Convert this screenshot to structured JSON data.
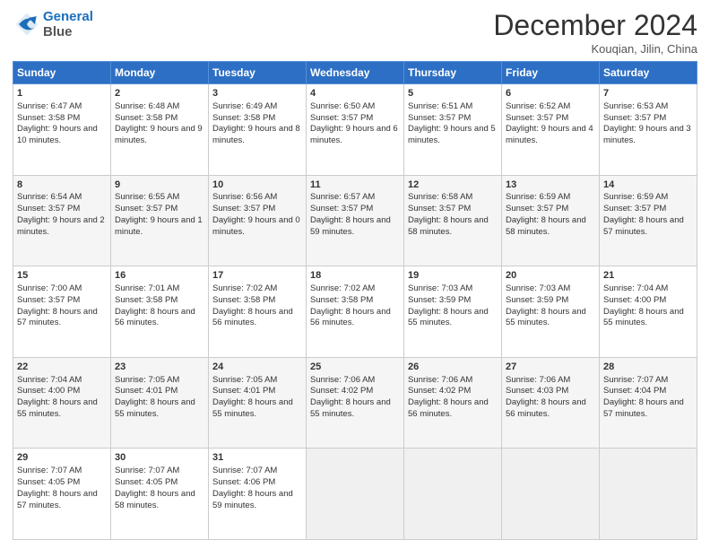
{
  "header": {
    "logo_line1": "General",
    "logo_line2": "Blue",
    "month": "December 2024",
    "location": "Kouqian, Jilin, China"
  },
  "weekdays": [
    "Sunday",
    "Monday",
    "Tuesday",
    "Wednesday",
    "Thursday",
    "Friday",
    "Saturday"
  ],
  "weeks": [
    [
      {
        "day": "1",
        "sunrise": "6:47 AM",
        "sunset": "3:58 PM",
        "daylight": "9 hours and 10 minutes."
      },
      {
        "day": "2",
        "sunrise": "6:48 AM",
        "sunset": "3:58 PM",
        "daylight": "9 hours and 9 minutes."
      },
      {
        "day": "3",
        "sunrise": "6:49 AM",
        "sunset": "3:58 PM",
        "daylight": "9 hours and 8 minutes."
      },
      {
        "day": "4",
        "sunrise": "6:50 AM",
        "sunset": "3:57 PM",
        "daylight": "9 hours and 6 minutes."
      },
      {
        "day": "5",
        "sunrise": "6:51 AM",
        "sunset": "3:57 PM",
        "daylight": "9 hours and 5 minutes."
      },
      {
        "day": "6",
        "sunrise": "6:52 AM",
        "sunset": "3:57 PM",
        "daylight": "9 hours and 4 minutes."
      },
      {
        "day": "7",
        "sunrise": "6:53 AM",
        "sunset": "3:57 PM",
        "daylight": "9 hours and 3 minutes."
      }
    ],
    [
      {
        "day": "8",
        "sunrise": "6:54 AM",
        "sunset": "3:57 PM",
        "daylight": "9 hours and 2 minutes."
      },
      {
        "day": "9",
        "sunrise": "6:55 AM",
        "sunset": "3:57 PM",
        "daylight": "9 hours and 1 minute."
      },
      {
        "day": "10",
        "sunrise": "6:56 AM",
        "sunset": "3:57 PM",
        "daylight": "9 hours and 0 minutes."
      },
      {
        "day": "11",
        "sunrise": "6:57 AM",
        "sunset": "3:57 PM",
        "daylight": "8 hours and 59 minutes."
      },
      {
        "day": "12",
        "sunrise": "6:58 AM",
        "sunset": "3:57 PM",
        "daylight": "8 hours and 58 minutes."
      },
      {
        "day": "13",
        "sunrise": "6:59 AM",
        "sunset": "3:57 PM",
        "daylight": "8 hours and 58 minutes."
      },
      {
        "day": "14",
        "sunrise": "6:59 AM",
        "sunset": "3:57 PM",
        "daylight": "8 hours and 57 minutes."
      }
    ],
    [
      {
        "day": "15",
        "sunrise": "7:00 AM",
        "sunset": "3:57 PM",
        "daylight": "8 hours and 57 minutes."
      },
      {
        "day": "16",
        "sunrise": "7:01 AM",
        "sunset": "3:58 PM",
        "daylight": "8 hours and 56 minutes."
      },
      {
        "day": "17",
        "sunrise": "7:02 AM",
        "sunset": "3:58 PM",
        "daylight": "8 hours and 56 minutes."
      },
      {
        "day": "18",
        "sunrise": "7:02 AM",
        "sunset": "3:58 PM",
        "daylight": "8 hours and 56 minutes."
      },
      {
        "day": "19",
        "sunrise": "7:03 AM",
        "sunset": "3:59 PM",
        "daylight": "8 hours and 55 minutes."
      },
      {
        "day": "20",
        "sunrise": "7:03 AM",
        "sunset": "3:59 PM",
        "daylight": "8 hours and 55 minutes."
      },
      {
        "day": "21",
        "sunrise": "7:04 AM",
        "sunset": "4:00 PM",
        "daylight": "8 hours and 55 minutes."
      }
    ],
    [
      {
        "day": "22",
        "sunrise": "7:04 AM",
        "sunset": "4:00 PM",
        "daylight": "8 hours and 55 minutes."
      },
      {
        "day": "23",
        "sunrise": "7:05 AM",
        "sunset": "4:01 PM",
        "daylight": "8 hours and 55 minutes."
      },
      {
        "day": "24",
        "sunrise": "7:05 AM",
        "sunset": "4:01 PM",
        "daylight": "8 hours and 55 minutes."
      },
      {
        "day": "25",
        "sunrise": "7:06 AM",
        "sunset": "4:02 PM",
        "daylight": "8 hours and 55 minutes."
      },
      {
        "day": "26",
        "sunrise": "7:06 AM",
        "sunset": "4:02 PM",
        "daylight": "8 hours and 56 minutes."
      },
      {
        "day": "27",
        "sunrise": "7:06 AM",
        "sunset": "4:03 PM",
        "daylight": "8 hours and 56 minutes."
      },
      {
        "day": "28",
        "sunrise": "7:07 AM",
        "sunset": "4:04 PM",
        "daylight": "8 hours and 57 minutes."
      }
    ],
    [
      {
        "day": "29",
        "sunrise": "7:07 AM",
        "sunset": "4:05 PM",
        "daylight": "8 hours and 57 minutes."
      },
      {
        "day": "30",
        "sunrise": "7:07 AM",
        "sunset": "4:05 PM",
        "daylight": "8 hours and 58 minutes."
      },
      {
        "day": "31",
        "sunrise": "7:07 AM",
        "sunset": "4:06 PM",
        "daylight": "8 hours and 59 minutes."
      },
      null,
      null,
      null,
      null
    ]
  ]
}
